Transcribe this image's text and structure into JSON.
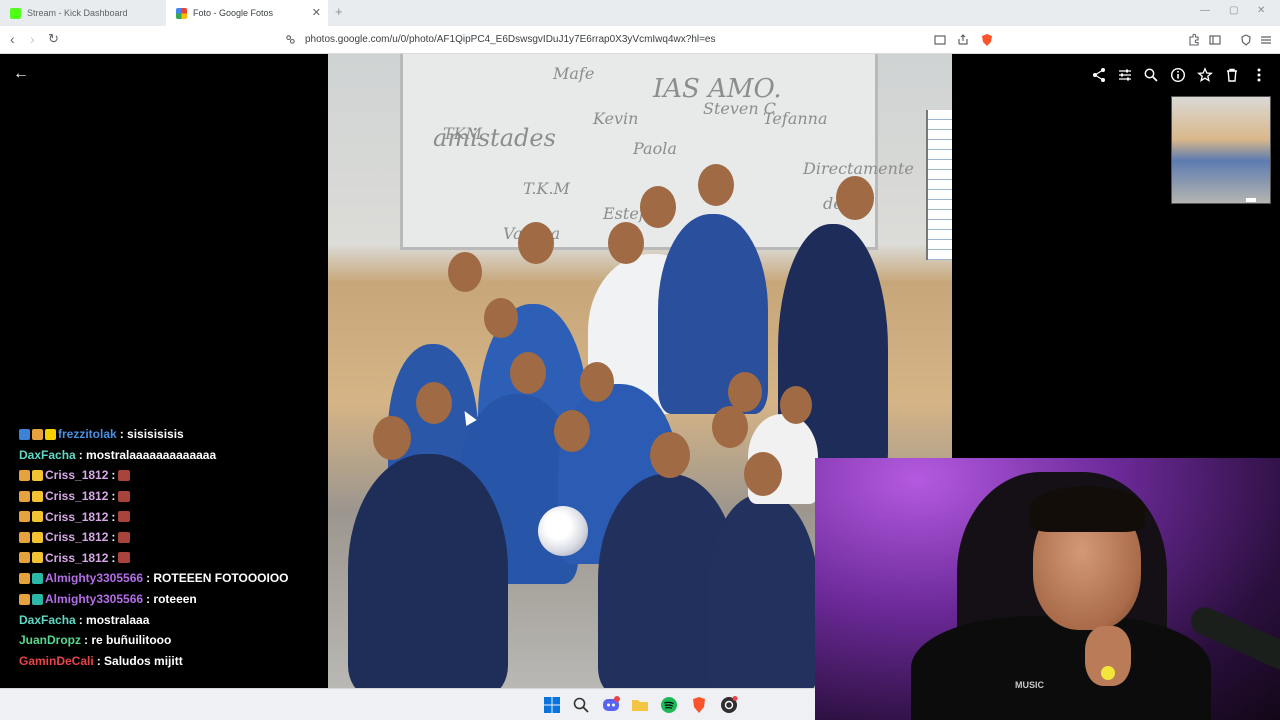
{
  "browser": {
    "tabs": [
      {
        "label": "Stream - Kick Dashboard",
        "favicon_color": "#53fc18"
      },
      {
        "label": "Foto - Google Fotos",
        "favicon_color": "#fbbc04"
      }
    ],
    "url": "photos.google.com/u/0/photo/AF1QipPC4_E6DswsgvIDuJ1y7E6rrap0X3yVcmIwq4wx?hl=es"
  },
  "photo": {
    "board_text": [
      "TKM",
      "Mafe",
      "Kevin",
      "IAS AMO.",
      "Steven C",
      "Tefanna",
      "amistades",
      "Paola",
      "T.K.M",
      "Directamente",
      "desde",
      "Vanesa",
      "Estefany"
    ]
  },
  "chat": {
    "messages": [
      {
        "user": "frezzitolak",
        "color": "#4a90e2",
        "text": ": sisisisisis",
        "badges": [
          "#3c82d8",
          "#e6a23c",
          "#f5d000"
        ],
        "emote": false
      },
      {
        "user": "DaxFacha",
        "color": "#5fd9c5",
        "text": ": mostralaaaaaaaaaaaaa",
        "badges": [],
        "emote": false
      },
      {
        "user": "Criss_1812",
        "color": "#d7a8e6",
        "text": ":",
        "badges": [
          "#e6a23c",
          "#f1c232"
        ],
        "emote": true
      },
      {
        "user": "Criss_1812",
        "color": "#d7a8e6",
        "text": ":",
        "badges": [
          "#e6a23c",
          "#f1c232"
        ],
        "emote": true
      },
      {
        "user": "Criss_1812",
        "color": "#d7a8e6",
        "text": ":",
        "badges": [
          "#e6a23c",
          "#f1c232"
        ],
        "emote": true
      },
      {
        "user": "Criss_1812",
        "color": "#d7a8e6",
        "text": ":",
        "badges": [
          "#e6a23c",
          "#f1c232"
        ],
        "emote": true
      },
      {
        "user": "Criss_1812",
        "color": "#d7a8e6",
        "text": ":",
        "badges": [
          "#e6a23c",
          "#f1c232"
        ],
        "emote": true
      },
      {
        "user": "Almighty3305566",
        "color": "#b36ee8",
        "text": ": ROTEEEN FOTOOOIOO",
        "badges": [
          "#e6a23c",
          "#2bb8a6"
        ],
        "emote": false
      },
      {
        "user": "Almighty3305566",
        "color": "#b36ee8",
        "text": ": roteeen",
        "badges": [
          "#e6a23c",
          "#2bb8a6"
        ],
        "emote": false
      },
      {
        "user": "DaxFacha",
        "color": "#5fd9c5",
        "text": ": mostralaaa",
        "badges": [],
        "emote": false
      },
      {
        "user": "JuanDropz",
        "color": "#58d68d",
        "text": ": re buñuilitooo",
        "badges": [],
        "emote": false
      },
      {
        "user": "GaminDeCali",
        "color": "#e8434b",
        "text": ": Saludos mijitt",
        "badges": [],
        "emote": false
      }
    ]
  },
  "viewer_toolbar": {
    "icons": [
      "share-icon",
      "tune-icon",
      "zoom-icon",
      "info-icon",
      "star-icon",
      "delete-icon",
      "more-icon"
    ]
  },
  "webcam": {
    "shirt_text": "MUSIC",
    "mic_label": "mic"
  },
  "taskbar": {
    "icons": [
      "windows-start-icon",
      "search-icon",
      "discord-icon",
      "file-explorer-icon",
      "spotify-icon",
      "brave-icon",
      "obs-icon"
    ],
    "discord_badge": "20"
  }
}
